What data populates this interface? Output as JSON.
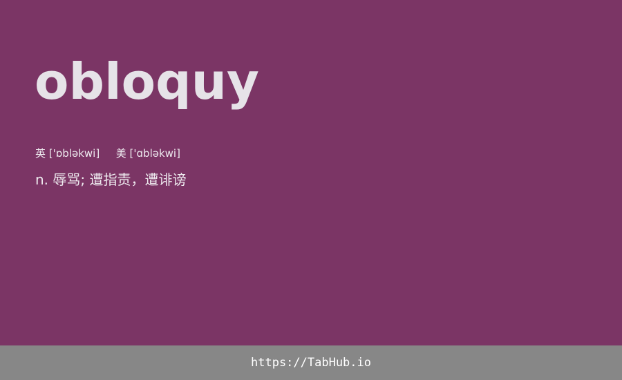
{
  "word": "obloquy",
  "phonetics": {
    "uk_label": "英",
    "uk_ipa": "['ɒbləkwi]",
    "us_label": "美",
    "us_ipa": "['ɑbləkwi]"
  },
  "definition": "n. 辱骂; 遭指责，遭诽谤",
  "footer": {
    "link_text": "https://TabHub.io"
  },
  "colors": {
    "background": "#7b3565",
    "footer_background": "#878787",
    "text": "#e9e6ea"
  }
}
